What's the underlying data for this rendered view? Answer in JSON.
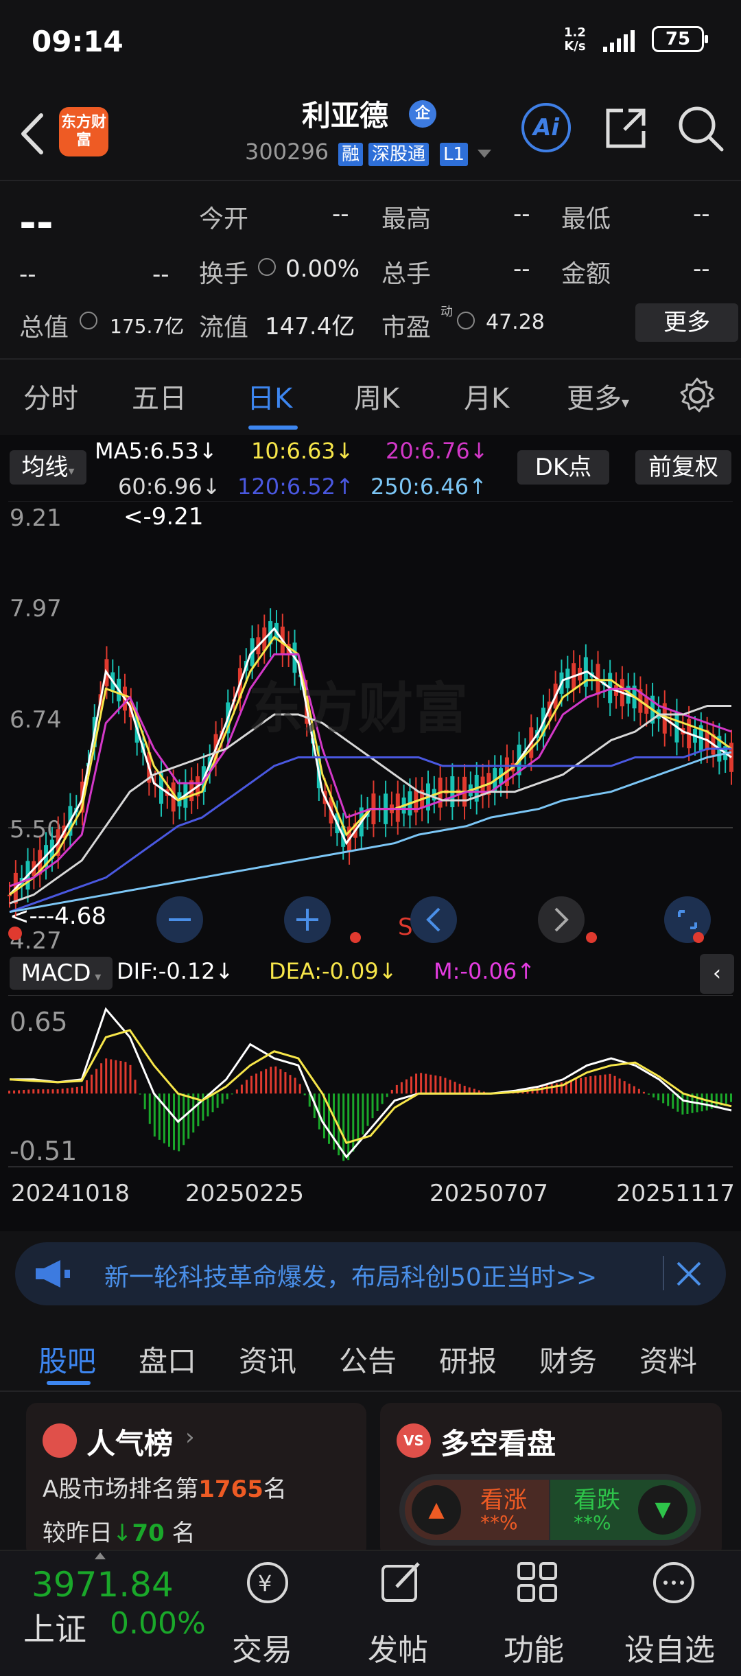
{
  "status": {
    "time": "09:14",
    "net_speed": "1.2",
    "net_unit": "K/s",
    "battery": "75"
  },
  "header": {
    "stock_name": "利亚德",
    "qi_badge": "企",
    "stock_code": "300296",
    "tags": [
      "融",
      "深股通",
      "L1"
    ],
    "logo_text": "东方财富",
    "ai_label": "Ai"
  },
  "quote": {
    "price": "--",
    "change": "--",
    "change_pct": "--",
    "rows": [
      [
        {
          "label": "今开",
          "value": "--"
        },
        {
          "label": "最高",
          "value": "--"
        },
        {
          "label": "最低",
          "value": "--"
        }
      ],
      [
        {
          "label": "换手",
          "value": "0.00%"
        },
        {
          "label": "总手",
          "value": "--"
        },
        {
          "label": "金额",
          "value": "--"
        }
      ]
    ],
    "total_cap_label": "总值",
    "total_cap": "175.7亿",
    "float_cap_label": "流值",
    "float_cap": "147.4亿",
    "pe_label": "市盈",
    "pe_sup": "动",
    "pe": "47.28",
    "more_label": "更多"
  },
  "period_tabs": [
    "分时",
    "五日",
    "日K",
    "周K",
    "月K",
    "更多"
  ],
  "active_tab": "日K",
  "chart_controls": {
    "ma_button": "均线",
    "dk_button": "DK点",
    "adjust_button": "前复权",
    "macd_button": "MACD"
  },
  "ma_legend": [
    {
      "text": "MA5:6.53↓",
      "color": "#ffffff"
    },
    {
      "text": "10:6.63↓",
      "color": "#f7e64a"
    },
    {
      "text": "20:6.76↓",
      "color": "#d338c8"
    },
    {
      "text": "60:6.96↓",
      "color": "#d8d8d8"
    },
    {
      "text": "120:6.52↑",
      "color": "#4a58e0"
    },
    {
      "text": "250:6.46↑",
      "color": "#7cc6f5"
    }
  ],
  "macd_legend": [
    {
      "text": "DIF:-0.12↓",
      "color": "#ffffff"
    },
    {
      "text": "DEA:-0.09↓",
      "color": "#f7e64a"
    },
    {
      "text": "M:-0.06↑",
      "color": "#e43ce0"
    }
  ],
  "chart_data": [
    {
      "type": "line",
      "title": "日K",
      "y_ticks": [
        "9.21",
        "7.97",
        "6.74",
        "5.50",
        "4.27"
      ],
      "ylim": [
        4.27,
        9.21
      ],
      "max_label": "<-9.21",
      "min_label": "<---4.68",
      "marker_label": "S",
      "series": [
        {
          "name": "MA5",
          "color": "#ffffff",
          "values": [
            4.8,
            5.1,
            5.4,
            5.9,
            7.4,
            7.0,
            6.1,
            5.9,
            6.1,
            6.8,
            7.6,
            7.9,
            7.5,
            6.0,
            5.4,
            5.8,
            5.8,
            5.9,
            6.0,
            6.0,
            6.1,
            6.3,
            6.7,
            7.3,
            7.4,
            7.2,
            7.1,
            6.9,
            6.7,
            6.6,
            6.4
          ]
        },
        {
          "name": "10",
          "color": "#f7e64a",
          "values": [
            4.8,
            5.0,
            5.3,
            5.8,
            7.2,
            7.1,
            6.3,
            5.9,
            6.0,
            6.7,
            7.4,
            7.8,
            7.6,
            6.2,
            5.5,
            5.8,
            5.8,
            5.9,
            6.0,
            6.0,
            6.1,
            6.3,
            6.6,
            7.1,
            7.3,
            7.3,
            7.1,
            6.9,
            6.8,
            6.7,
            6.5
          ]
        },
        {
          "name": "20",
          "color": "#d338c8",
          "values": [
            4.9,
            5.0,
            5.2,
            5.5,
            6.8,
            7.1,
            6.5,
            6.1,
            6.1,
            6.5,
            7.2,
            7.6,
            7.6,
            6.5,
            5.7,
            5.8,
            5.8,
            5.8,
            5.9,
            6.0,
            6.0,
            6.2,
            6.4,
            6.9,
            7.1,
            7.2,
            7.2,
            7.0,
            6.9,
            6.8,
            6.7
          ]
        },
        {
          "name": "60",
          "color": "#d8d8d8",
          "values": [
            4.7,
            4.8,
            5.0,
            5.2,
            5.6,
            6.0,
            6.2,
            6.3,
            6.4,
            6.5,
            6.7,
            6.9,
            6.9,
            6.8,
            6.6,
            6.4,
            6.2,
            6.0,
            5.9,
            5.9,
            6.0,
            6.0,
            6.1,
            6.2,
            6.4,
            6.6,
            6.7,
            6.9,
            6.9,
            7.0,
            7.0
          ]
        },
        {
          "name": "120",
          "color": "#4a58e0",
          "values": [
            4.6,
            4.7,
            4.8,
            4.9,
            5.0,
            5.2,
            5.4,
            5.6,
            5.7,
            5.9,
            6.1,
            6.3,
            6.4,
            6.4,
            6.4,
            6.4,
            6.4,
            6.4,
            6.3,
            6.3,
            6.3,
            6.3,
            6.3,
            6.3,
            6.3,
            6.3,
            6.4,
            6.4,
            6.4,
            6.5,
            6.5
          ]
        },
        {
          "name": "250",
          "color": "#7cc6f5",
          "values": [
            4.6,
            4.65,
            4.7,
            4.75,
            4.8,
            4.85,
            4.9,
            4.95,
            5.0,
            5.05,
            5.1,
            5.15,
            5.2,
            5.25,
            5.3,
            5.35,
            5.4,
            5.5,
            5.55,
            5.6,
            5.7,
            5.75,
            5.8,
            5.9,
            5.95,
            6.0,
            6.1,
            6.2,
            6.3,
            6.4,
            6.46
          ]
        }
      ]
    },
    {
      "type": "bar",
      "title": "MACD",
      "y_ticks": [
        "0.65",
        "-0.51"
      ],
      "ylim": [
        -0.51,
        0.65
      ],
      "x_ticks": [
        "20241018",
        "20250225",
        "20250707",
        "20251117"
      ],
      "series": [
        {
          "name": "M",
          "values": [
            0.02,
            0.03,
            0.03,
            0.05,
            0.25,
            0.22,
            -0.3,
            -0.42,
            -0.2,
            -0.05,
            0.12,
            0.2,
            0.1,
            -0.3,
            -0.5,
            -0.2,
            0.05,
            0.15,
            0.12,
            0.05,
            0.0,
            0.02,
            0.05,
            0.08,
            0.12,
            0.14,
            0.05,
            -0.05,
            -0.15,
            -0.12,
            -0.06
          ]
        },
        {
          "name": "DIF",
          "values": [
            0.1,
            0.1,
            0.08,
            0.1,
            0.6,
            0.4,
            0.0,
            -0.2,
            -0.05,
            0.1,
            0.35,
            0.25,
            0.2,
            -0.2,
            -0.45,
            -0.25,
            -0.05,
            0.0,
            0.0,
            0.0,
            0.0,
            0.02,
            0.05,
            0.1,
            0.2,
            0.25,
            0.2,
            0.1,
            -0.05,
            -0.08,
            -0.12
          ]
        },
        {
          "name": "DEA",
          "values": [
            0.1,
            0.09,
            0.08,
            0.09,
            0.4,
            0.45,
            0.2,
            0.0,
            -0.05,
            0.05,
            0.2,
            0.3,
            0.25,
            0.0,
            -0.35,
            -0.3,
            -0.1,
            0.0,
            0.0,
            0.0,
            0.0,
            0.01,
            0.03,
            0.06,
            0.15,
            0.2,
            0.22,
            0.12,
            0.0,
            -0.05,
            -0.09
          ]
        }
      ]
    }
  ],
  "banner": {
    "text": "新一轮科技革命爆发，布局科创50正当时>>"
  },
  "section_tabs": [
    "股吧",
    "盘口",
    "资讯",
    "公告",
    "研报",
    "财务",
    "资料"
  ],
  "active_section": "股吧",
  "popularity": {
    "title": "人气榜",
    "line1_pre": "A股市场排名第",
    "rank": "1765",
    "line1_post": "名",
    "line2_pre": "较昨日",
    "delta": "70",
    "line2_post": "名"
  },
  "longshort": {
    "title": "多空看盘",
    "badge": "VS",
    "bull": "看涨",
    "bull_pct": "**%",
    "bear": "看跌",
    "bear_pct": "**%"
  },
  "bottom_nav": {
    "index_value": "3971.84",
    "index_name": "上证",
    "index_pct": "0.00%",
    "items": [
      "交易",
      "发帖",
      "功能",
      "设自选"
    ]
  },
  "colors": {
    "up": "#e03a2f",
    "down": "#1aa82a",
    "accent": "#3d86f0",
    "bg": "#121214"
  }
}
